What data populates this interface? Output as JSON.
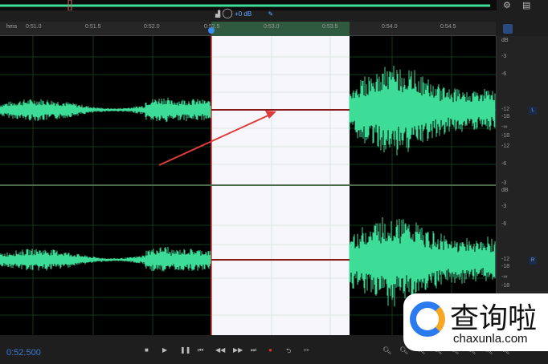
{
  "ruler": {
    "unit": "hms",
    "ticks": [
      "0:51.0",
      "0:51.5",
      "0:52.0",
      "0:52.5",
      "0:53.0",
      "0:53.5",
      "0:54.0",
      "0:54.5"
    ]
  },
  "hud": {
    "gain": "+0 dB"
  },
  "db_scale": {
    "unit": "dB",
    "labels": [
      "-3",
      "-6",
      "-12",
      "-18",
      "-∞",
      "-18",
      "-12",
      "-6",
      "-3"
    ]
  },
  "channels": {
    "left": "L",
    "right": "R"
  },
  "transport": {
    "current_time": "0:52.500",
    "buttons": [
      "stop",
      "play",
      "pause",
      "go-to-start",
      "rewind",
      "fast-forward",
      "go-to-end",
      "record",
      "loop",
      "skip-selection"
    ]
  },
  "zoom_buttons": [
    "zoom-in-amplitude",
    "zoom-out-amplitude",
    "zoom-in",
    "zoom-out",
    "zoom-out-full",
    "zoom-in-point",
    "zoom-to-selection",
    "zoom-full"
  ],
  "colors": {
    "waveform": "#3ddc97",
    "selection": "#f6f6fb",
    "accent": "#3a7bd5",
    "arrow": "#e03a3a"
  },
  "watermark": {
    "text": "查询啦",
    "url": "chaxunla.com"
  }
}
